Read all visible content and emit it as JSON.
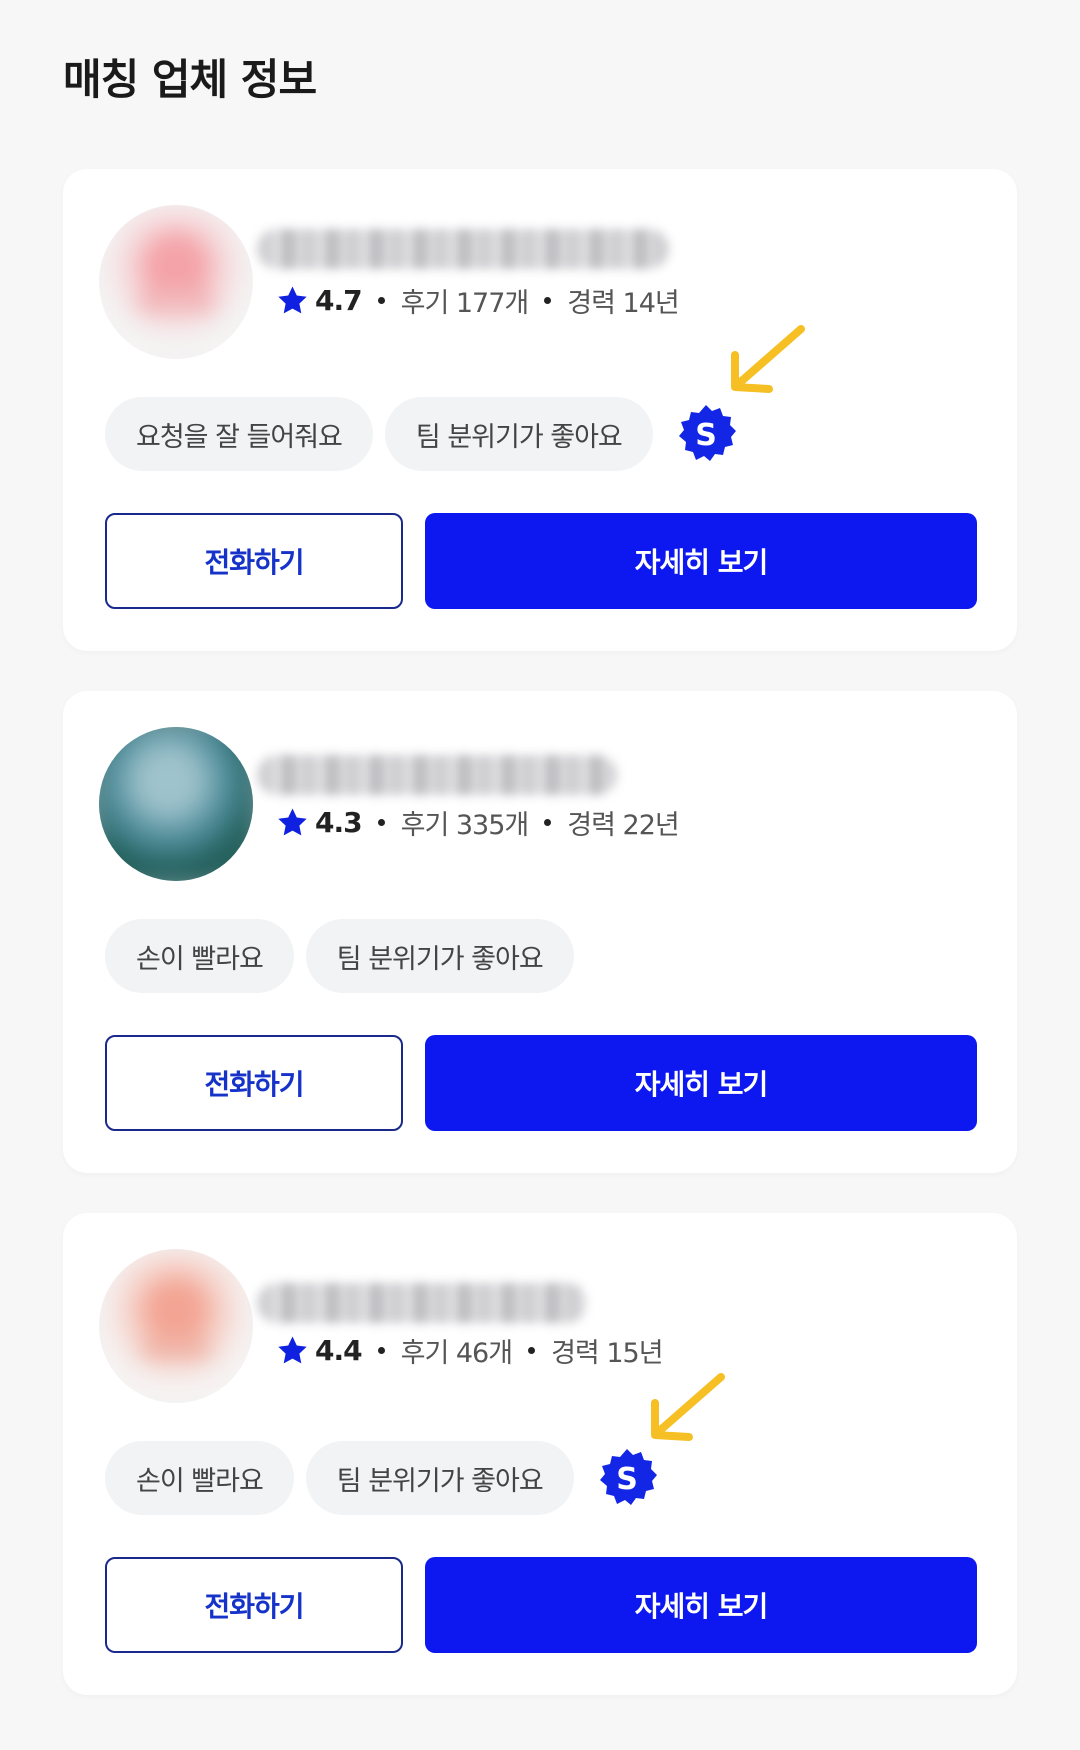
{
  "section": {
    "title": "매칭 업체 정보"
  },
  "colors": {
    "accent": "#0d18f0",
    "arrow": "#f6c024",
    "tag_bg": "#f2f3f5"
  },
  "cards": [
    {
      "rating": "4.7",
      "reviews": "후기 177개",
      "career": "경력 14년",
      "tags": [
        "요청을 잘 들어줘요",
        "팀 분위기가 좋아요"
      ],
      "badge": "S",
      "call_label": "전화하기",
      "detail_label": "자세히 보기"
    },
    {
      "rating": "4.3",
      "reviews": "후기 335개",
      "career": "경력 22년",
      "tags": [
        "손이 빨라요",
        "팀 분위기가 좋아요"
      ],
      "call_label": "전화하기",
      "detail_label": "자세히 보기"
    },
    {
      "rating": "4.4",
      "reviews": "후기 46개",
      "career": "경력 15년",
      "tags": [
        "손이 빨라요",
        "팀 분위기가 좋아요"
      ],
      "badge": "S",
      "call_label": "전화하기",
      "detail_label": "자세히 보기"
    }
  ]
}
